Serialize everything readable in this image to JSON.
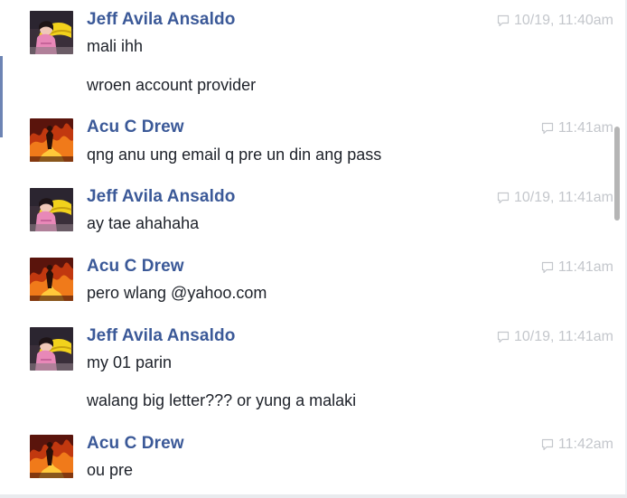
{
  "messages": [
    {
      "author": "Jeff Avila Ansaldo",
      "avatar_icon": "girl-with-yellow-umbrella-avatar",
      "timestamp": "10/19, 11:40am",
      "lines": [
        "mali ihh",
        "wroen account provider"
      ]
    },
    {
      "author": "Acu C Drew",
      "avatar_icon": "fire-scene-avatar",
      "timestamp": "11:41am",
      "lines": [
        "qng anu ung email q pre un din ang pass"
      ]
    },
    {
      "author": "Jeff Avila Ansaldo",
      "avatar_icon": "girl-with-yellow-umbrella-avatar",
      "timestamp": "10/19, 11:41am",
      "lines": [
        "ay tae ahahaha"
      ]
    },
    {
      "author": "Acu C Drew",
      "avatar_icon": "fire-scene-avatar",
      "timestamp": "11:41am",
      "lines": [
        "pero wlang @yahoo.com"
      ]
    },
    {
      "author": "Jeff Avila Ansaldo",
      "avatar_icon": "girl-with-yellow-umbrella-avatar",
      "timestamp": "10/19, 11:41am",
      "lines": [
        "my 01 parin",
        "walang big letter??? or yung a malaki"
      ]
    },
    {
      "author": "Acu C Drew",
      "avatar_icon": "fire-scene-avatar",
      "timestamp": "11:42am",
      "lines": [
        "ou pre"
      ]
    }
  ],
  "colors": {
    "author": "#3b5998",
    "timestamp": "#c4c7cc",
    "text": "#1d2129",
    "accent": "#6d84b4"
  }
}
